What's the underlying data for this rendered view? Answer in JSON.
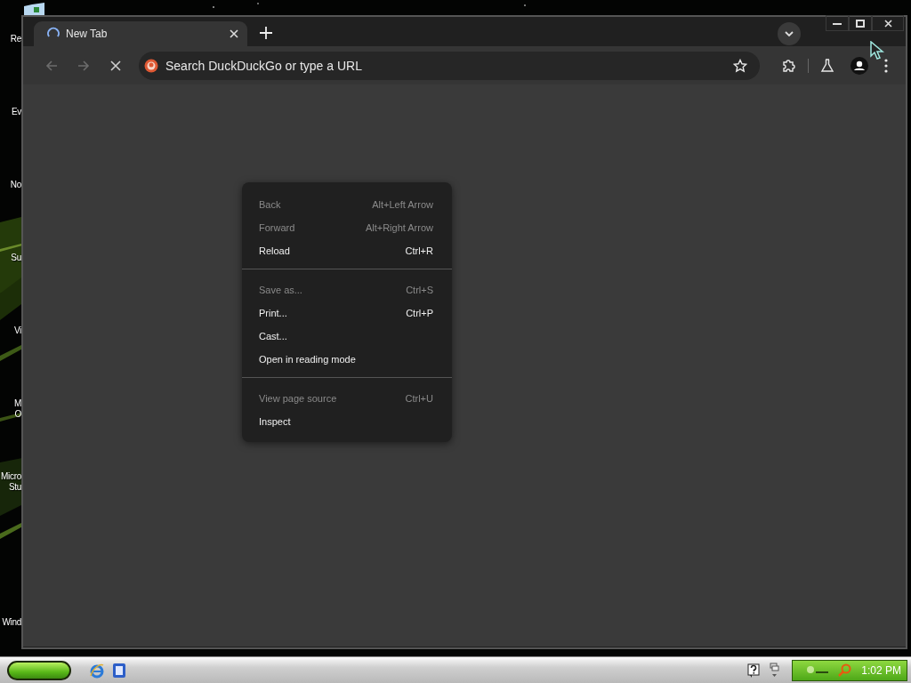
{
  "desktop": {
    "icons": [
      {
        "lines": [
          "Re"
        ]
      },
      {
        "lines": [
          "Ev"
        ]
      },
      {
        "lines": [
          "No"
        ]
      },
      {
        "lines": [
          "Su"
        ]
      },
      {
        "lines": [
          "Vi"
        ]
      },
      {
        "lines": [
          "M",
          "O"
        ]
      },
      {
        "lines": [
          "Micro",
          "Stu"
        ]
      },
      {
        "lines": [
          "Wind"
        ]
      }
    ]
  },
  "browser": {
    "tabs": [
      {
        "title": "New Tab",
        "selected": true,
        "loading": true
      }
    ],
    "nav_buttons": [
      {
        "kind": "back",
        "disabled": true
      },
      {
        "kind": "forward",
        "disabled": true
      },
      {
        "kind": "stop",
        "disabled": false
      }
    ],
    "omnibox": {
      "placeholder": "Search DuckDuckGo or type a URL"
    }
  },
  "context_menu": {
    "groups": [
      [
        {
          "label": "Back",
          "shortcut": "Alt+Left Arrow",
          "disabled": true
        },
        {
          "label": "Forward",
          "shortcut": "Alt+Right Arrow",
          "disabled": true
        },
        {
          "label": "Reload",
          "shortcut": "Ctrl+R",
          "disabled": false
        }
      ],
      [
        {
          "label": "Save as...",
          "shortcut": "Ctrl+S",
          "disabled": true
        },
        {
          "label": "Print...",
          "shortcut": "Ctrl+P",
          "disabled": false
        },
        {
          "label": "Cast...",
          "disabled": false
        },
        {
          "label": "Open in reading mode",
          "disabled": false
        }
      ],
      [
        {
          "label": "View page source",
          "shortcut": "Ctrl+U",
          "disabled": true
        },
        {
          "label": "Inspect",
          "disabled": false
        }
      ]
    ]
  },
  "taskbar": {
    "clock": "1:02 PM"
  }
}
